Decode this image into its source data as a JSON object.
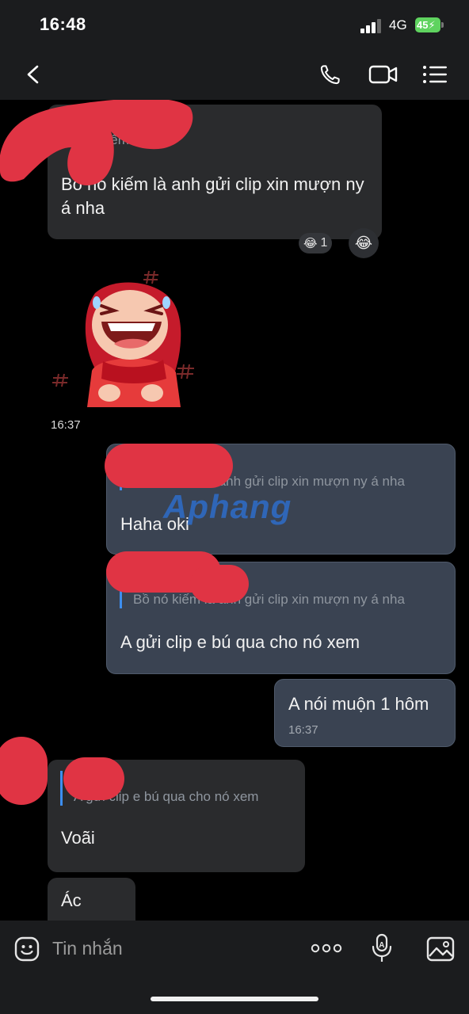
{
  "status_bar": {
    "time": "16:48",
    "network": "4G",
    "battery": "45"
  },
  "header": {
    "title": "",
    "icons": [
      "back-arrow",
      "phone",
      "video-camera",
      "list-menu"
    ]
  },
  "messages": [
    {
      "direction": "in",
      "quote_sender": "",
      "quote": "Qua đêm nhoa",
      "text": "Bồ nó kiếm là anh gửi clip xin mượn ny á nha",
      "reactions": [
        {
          "emoji": "😂",
          "count": "1"
        }
      ],
      "reaction_add_emoji": "😂"
    },
    {
      "direction": "in",
      "type": "sticker",
      "sticker": "laughing-red-haired-girl",
      "time": "16:37"
    },
    {
      "direction": "out",
      "quote_sender": "",
      "quote": "Bồ nó kiếm là anh gửi clip xin mượn ny á nha",
      "text": "Haha oki"
    },
    {
      "direction": "out",
      "quote_sender": "",
      "quote": "Bồ nó kiếm là anh gửi clip xin mượn ny á nha",
      "text": "A gửi clip e bú qua cho nó xem"
    },
    {
      "direction": "out",
      "text": "A nói muộn 1 hôm",
      "time": "16:37"
    },
    {
      "direction": "in",
      "quote_sender": "",
      "quote": "A gửi clip e bú qua cho nó xem",
      "text": "Voãi"
    },
    {
      "direction": "in",
      "text": "Ác"
    }
  ],
  "watermark": "Aphang",
  "composer": {
    "placeholder": "Tin nhắn",
    "icons": [
      "emoji-smile",
      "more-dots",
      "voice-mic",
      "image-gallery"
    ]
  },
  "colors": {
    "background": "#000000",
    "bar": "#1b1c1e",
    "incoming_bubble": "#2a2b2d",
    "outgoing_bubble": "#3a4352",
    "quote_accent": "#3d8ef0",
    "redaction": "#e03444"
  }
}
